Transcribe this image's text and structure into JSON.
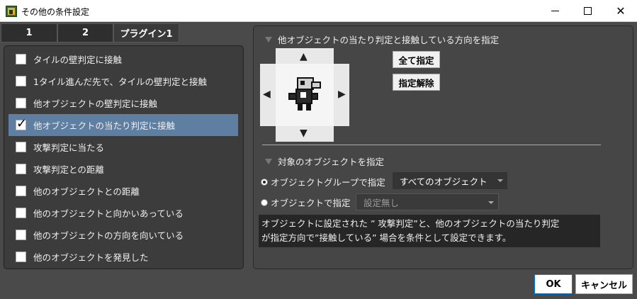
{
  "window": {
    "title": "その他の条件設定",
    "close_glyph": "✕"
  },
  "tabs": [
    {
      "label": "1"
    },
    {
      "label": "2"
    },
    {
      "label": "プラグイン1"
    }
  ],
  "conditions": [
    {
      "label": "タイルの壁判定に接触",
      "checked": false
    },
    {
      "label": "1タイル進んだ先で、タイルの壁判定と接触",
      "checked": false
    },
    {
      "label": "他オブジェクトの壁判定に接触",
      "checked": false
    },
    {
      "label": "他オブジェクトの当たり判定に接触",
      "checked": true
    },
    {
      "label": "攻撃判定に当たる",
      "checked": false
    },
    {
      "label": "攻撃判定との距離",
      "checked": false
    },
    {
      "label": "他のオブジェクトとの距離",
      "checked": false
    },
    {
      "label": "他のオブジェクトと向かいあっている",
      "checked": false
    },
    {
      "label": "他のオブジェクトの方向を向いている",
      "checked": false
    },
    {
      "label": "他のオブジェクトを発見した",
      "checked": false
    }
  ],
  "direction_section": {
    "title": "他オブジェクトの当たり判定と接触している方向を指定",
    "arrows": {
      "up": "▲",
      "down": "▼",
      "left": "◀",
      "right": "▶"
    },
    "select_all_label": "全て指定",
    "clear_label": "指定解除"
  },
  "target_section": {
    "title": "対象のオブジェクトを指定",
    "group_option_label": "オブジェクトグループで指定",
    "group_selected": "すべてのオブジェクト",
    "object_option_label": "オブジェクトで指定",
    "object_selected": "設定無し",
    "selected_option": "group"
  },
  "description": {
    "line1": "オブジェクトに設定された ” 攻撃判定”と、他のオブジェクトの当たり判定",
    "line2": "が指定方向で”接触している” 場合を条件として設定できます。"
  },
  "footer": {
    "ok_label": "OK",
    "cancel_label": "キャンセル"
  }
}
